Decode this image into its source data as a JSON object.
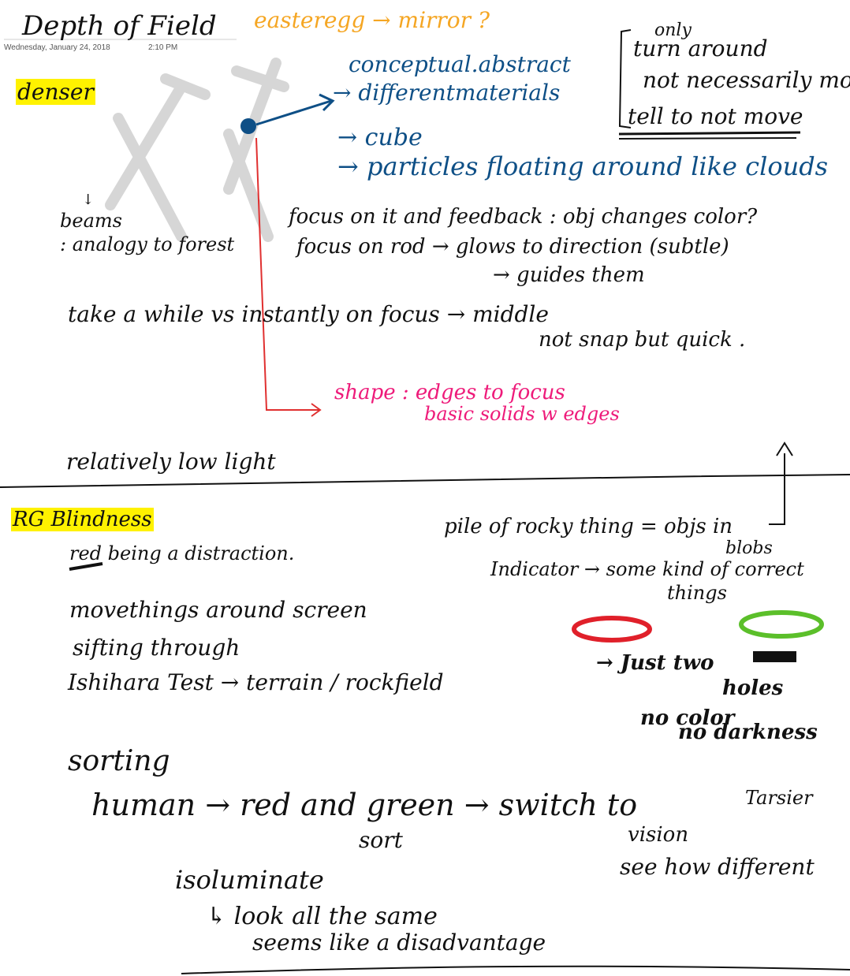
{
  "page": {
    "title": "Depth of Field",
    "date": "Wednesday, January 24, 2018",
    "time": "2:10 PM"
  },
  "notes": {
    "easter_egg": "easteregg → mirror ?",
    "denser": "denser",
    "concept_line1": "conceptual.abstract",
    "concept_line2": "→ differentmaterials",
    "cube": "→ cube",
    "particles": "→ particles floating around like clouds",
    "bracket_only": "only",
    "bracket_turn": "turn around",
    "bracket_not_move": "not necessarily move",
    "bracket_tell": "tell to not move",
    "beams_mark": "↓",
    "beams": "beams",
    "analogy": ": analogy to forest",
    "focus_feedback": "focus on it and feedback : obj changes color?",
    "focus_rod": "focus on rod → glows to direction (subtle)",
    "guides": "→ guides them",
    "take_while": "take a while vs instantly on focus → middle",
    "not_snap": "not snap but quick .",
    "shape_edges": "shape : edges to focus",
    "basic_solids": "basic solids w edges",
    "low_light": "relatively low light",
    "rg_blindness": "RG Blindness",
    "red_distraction": "red being a distraction.",
    "pile": "pile of rocky thing = objs in",
    "blobs": "blobs",
    "indicator": "Indicator → some kind of correct",
    "things": "things",
    "move_things": "movethings around screen",
    "sifting": "sifting through",
    "ishihara": "Ishihara Test → terrain / rockfield",
    "just_two": "→ Just two",
    "holes": "holes",
    "no_color": "no color",
    "no_darkness": "no darkness",
    "sorting": "sorting",
    "human_line": "human → red and green → switch to",
    "tarsier": "Tarsier",
    "sort": "sort",
    "vision": "vision",
    "see_how": "see how different",
    "isoluminate": "isoluminate",
    "look_same": "↳ look all the same",
    "disadvantage": "seems like a disadvantage"
  },
  "colors": {
    "ink_black": "#111111",
    "ink_blue": "#0e4f86",
    "ink_orange": "#f5a623",
    "ink_pink": "#ee1b7a",
    "ink_red": "#e0202a",
    "ink_green": "#5bbf2a",
    "highlight": "#fff200",
    "gray_x": "#d6d6d6",
    "line_red": "#e03030"
  }
}
